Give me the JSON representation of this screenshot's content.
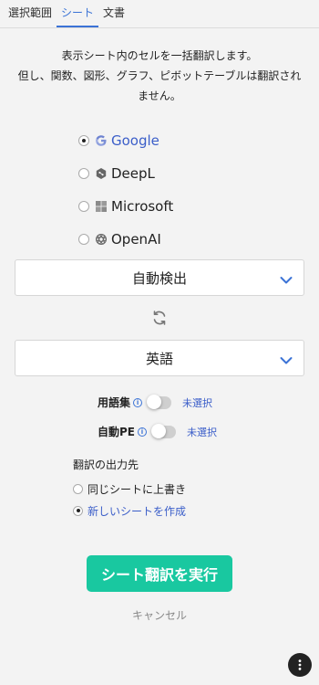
{
  "tabs": [
    {
      "label": "選択範囲",
      "active": false
    },
    {
      "label": "シート",
      "active": true
    },
    {
      "label": "文書",
      "active": false
    }
  ],
  "description": {
    "line1": "表示シート内のセルを一括翻訳します。",
    "line2": "但し、関数、図形、グラフ、ピボットテーブルは翻訳され",
    "line3": "ません。"
  },
  "engines": [
    {
      "label": "Google",
      "icon": "google-icon",
      "selected": true
    },
    {
      "label": "DeepL",
      "icon": "deepl-icon",
      "selected": false
    },
    {
      "label": "Microsoft",
      "icon": "microsoft-icon",
      "selected": false
    },
    {
      "label": "OpenAI",
      "icon": "openai-icon",
      "selected": false
    }
  ],
  "source_language": {
    "value": "自動検出"
  },
  "target_language": {
    "value": "英語"
  },
  "glossary": {
    "label": "用語集",
    "info_icon": "i",
    "state": "未選択",
    "enabled": false
  },
  "auto_pe": {
    "label": "自動PE",
    "info_icon": "i",
    "state": "未選択",
    "enabled": false
  },
  "output": {
    "title": "翻訳の出力先",
    "options": [
      {
        "label": "同じシートに上書き",
        "selected": false
      },
      {
        "label": "新しいシートを作成",
        "selected": true
      }
    ]
  },
  "actions": {
    "run_label": "シート翻訳を実行",
    "cancel_label": "キャンセル"
  },
  "colors": {
    "accent": "#3b73d6",
    "primary_button": "#19c8a0",
    "background": "#f3f3f3"
  }
}
